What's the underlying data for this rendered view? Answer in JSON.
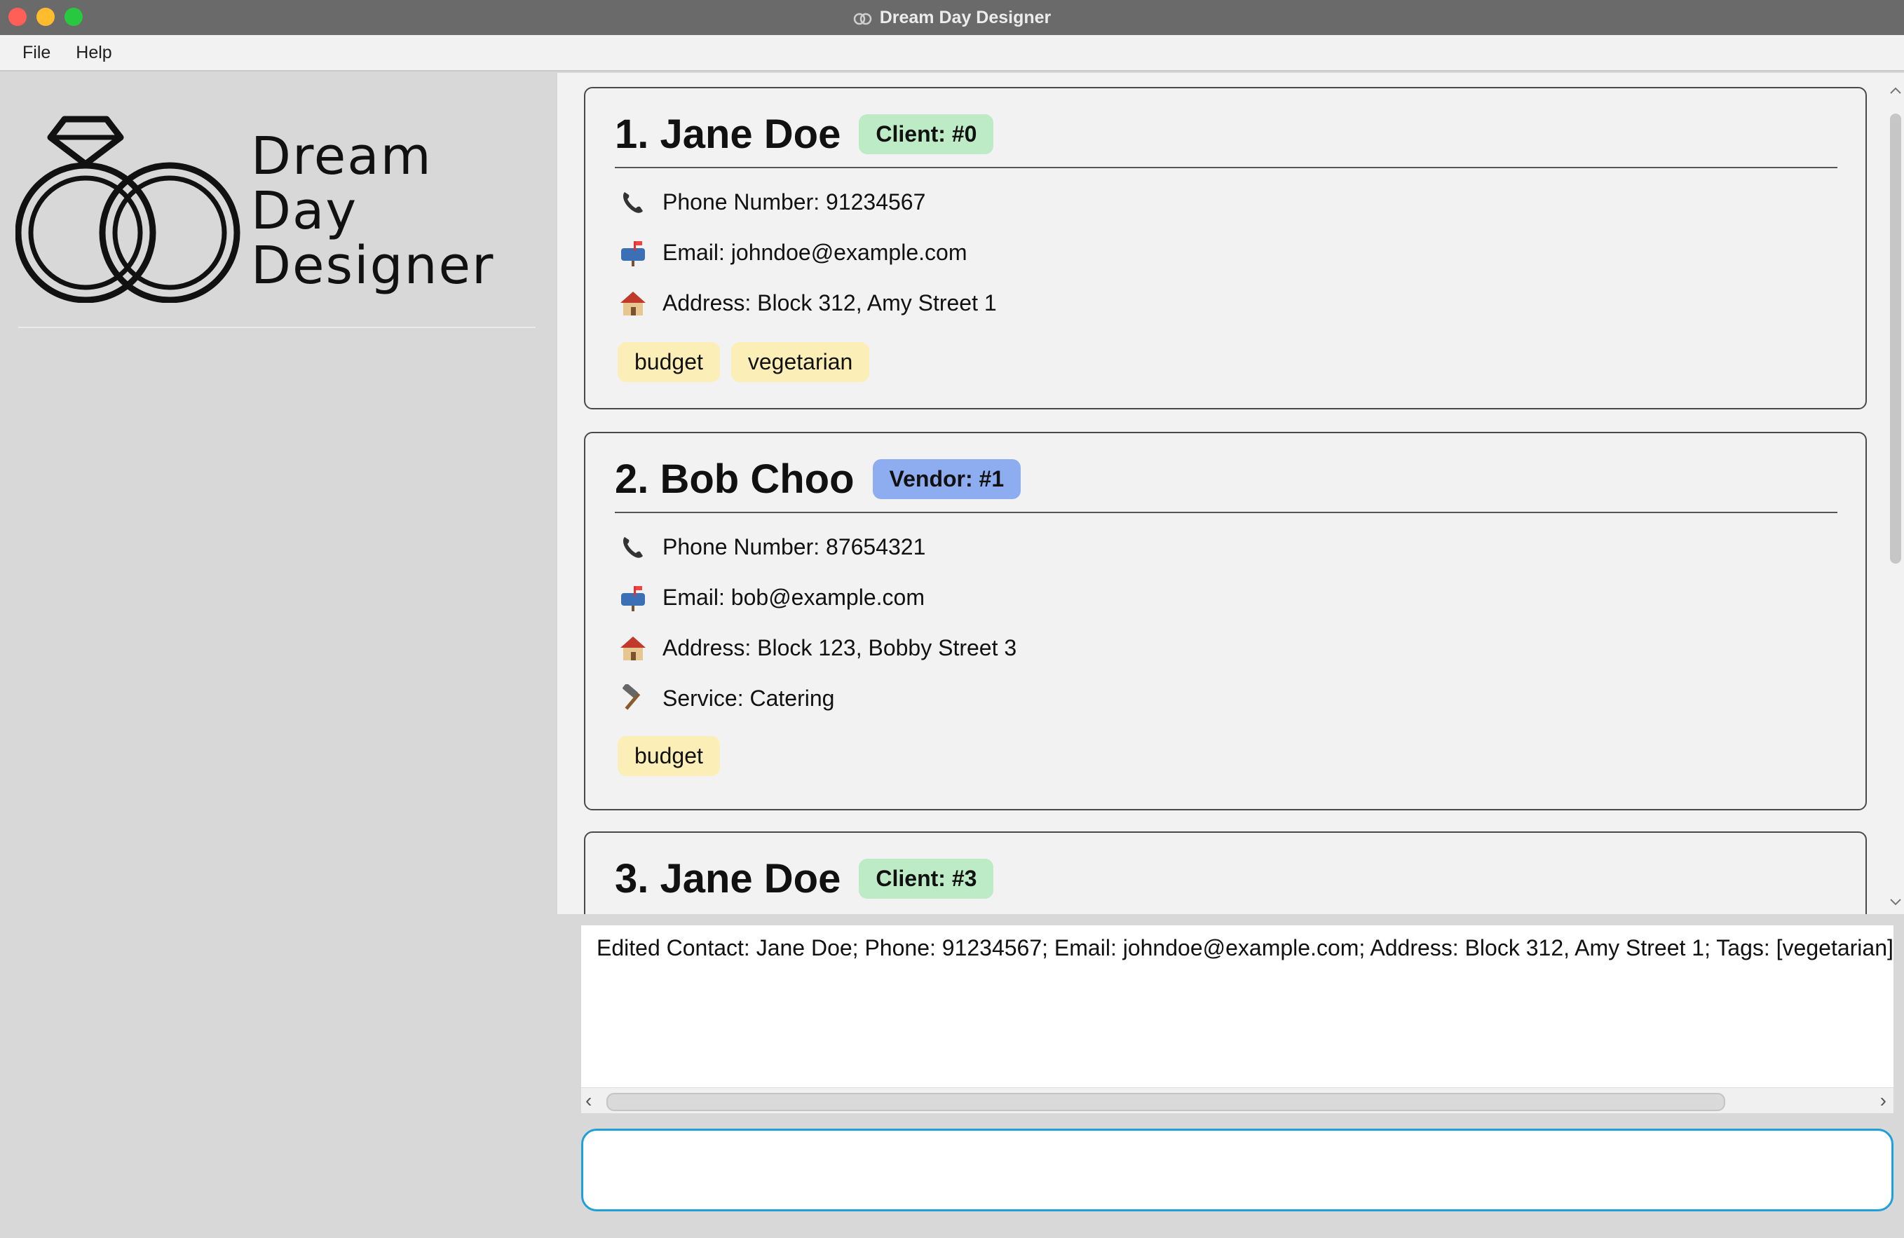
{
  "window": {
    "title": "Dream Day Designer"
  },
  "menu": {
    "file": "File",
    "help": "Help"
  },
  "sidebar": {
    "logo_lines": [
      "Dream",
      "Day",
      "Designer"
    ]
  },
  "contacts": [
    {
      "title": "1. Jane Doe",
      "badge": "Client: #0",
      "badge_type": "client",
      "phone": "Phone Number: 91234567",
      "email": "Email: johndoe@example.com",
      "address": "Address: Block 312, Amy Street 1",
      "tags": [
        "budget",
        "vegetarian"
      ]
    },
    {
      "title": "2. Bob Choo",
      "badge": "Vendor: #1",
      "badge_type": "vendor",
      "phone": "Phone Number: 87654321",
      "email": "Email: bob@example.com",
      "address": "Address: Block 123, Bobby Street 3",
      "service": "Service: Catering",
      "tags": [
        "budget"
      ]
    },
    {
      "title": "3. Jane Doe",
      "badge": "Client: #3",
      "badge_type": "client"
    }
  ],
  "result": {
    "text": "Edited Contact: Jane Doe; Phone: 91234567; Email: johndoe@example.com; Address: Block 312, Amy Street 1; Tags: [vegetarian]"
  },
  "command": {
    "value": "",
    "placeholder": ""
  },
  "colors": {
    "client_badge": "#bcebc5",
    "vendor_badge": "#8eadf0",
    "tag": "#fbefb7",
    "command_border": "#20a0d8"
  },
  "icons": {
    "phone": "phone-icon",
    "email": "mailbox-icon",
    "address": "house-icon",
    "service": "hammer-icon"
  }
}
